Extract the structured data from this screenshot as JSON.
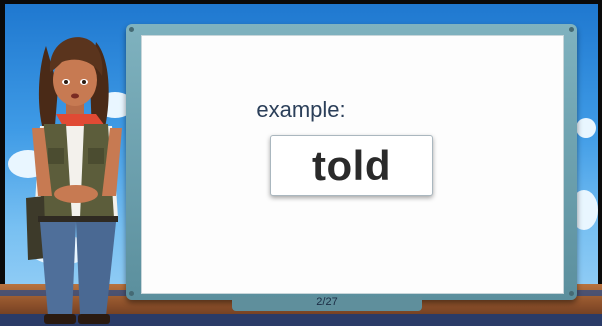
{
  "board": {
    "prompt_label": "example:",
    "word": "told",
    "counter": "2/27"
  }
}
